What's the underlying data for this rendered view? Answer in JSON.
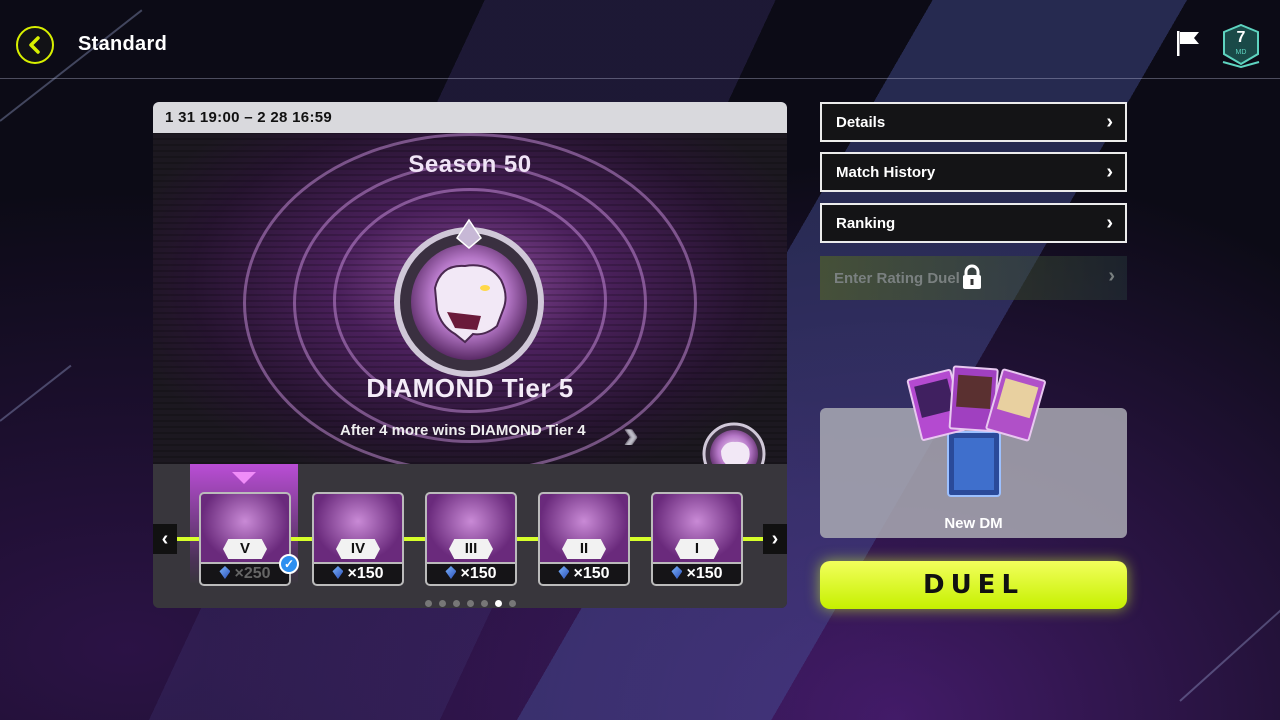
{
  "header": {
    "title": "Standard",
    "level": "7",
    "level_sub": "MD"
  },
  "season": {
    "date_range": "1 31 19:00 – 2 28 16:59",
    "name": "Season 50",
    "tier_name": "DIAMOND Tier 5",
    "tier_hint": "After 4 more wins DIAMOND Tier 4",
    "current_tier_numeral": "V",
    "next_tier_numeral": "IV"
  },
  "tiers": [
    {
      "numeral": "V",
      "reward": "×250",
      "claimed": true
    },
    {
      "numeral": "IV",
      "reward": "×150",
      "claimed": false
    },
    {
      "numeral": "III",
      "reward": "×150",
      "claimed": false
    },
    {
      "numeral": "II",
      "reward": "×150",
      "claimed": false
    },
    {
      "numeral": "I",
      "reward": "×150",
      "claimed": false
    }
  ],
  "pagination": {
    "count": 7,
    "active_index": 5
  },
  "menu": {
    "details": "Details",
    "match_history": "Match History",
    "ranking": "Ranking",
    "enter_rating_duel": "Enter Rating Duel"
  },
  "deck": {
    "name": "New DM"
  },
  "duel_label": "DUEL",
  "colors": {
    "accent": "#d6ff2a",
    "tier_purple": "#b05cc8",
    "check": "#2c8ff0"
  }
}
